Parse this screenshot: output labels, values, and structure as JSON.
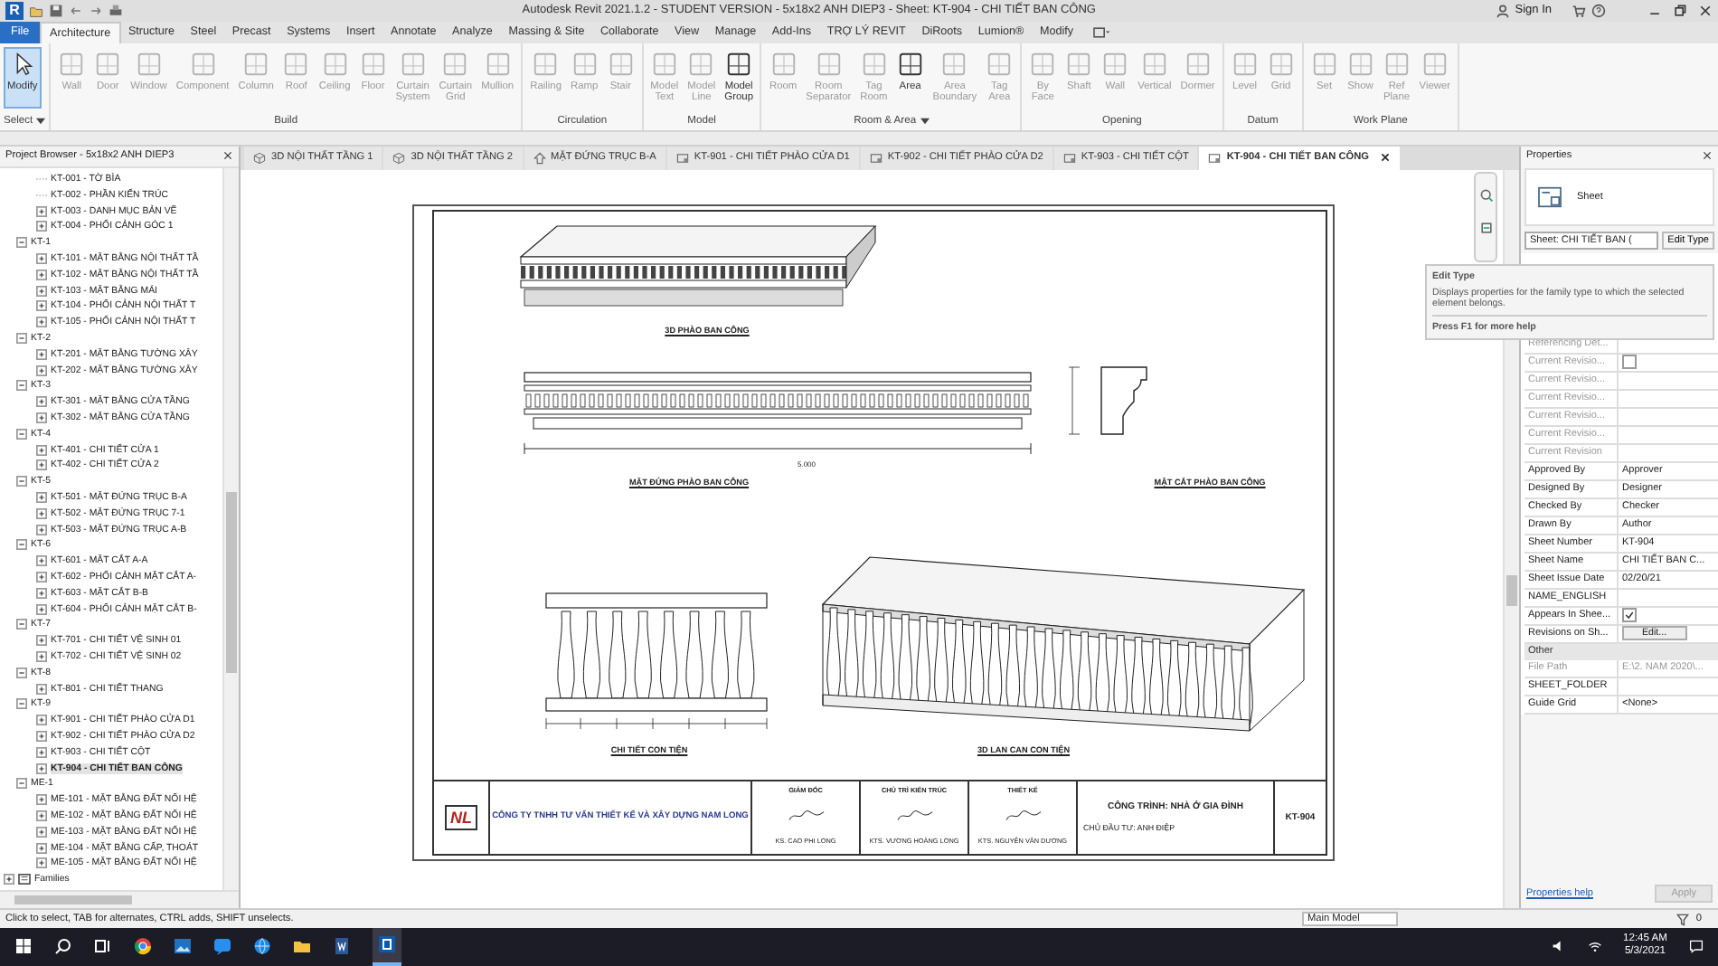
{
  "title_bar": {
    "app_logo": "R",
    "title": "Autodesk Revit 2021.1.2 - STUDENT VERSION - 5x18x2 ANH DIEP3 - Sheet: KT-904 - CHI TIẾT BAN CÔNG",
    "sign_in": "Sign In"
  },
  "ribbon_tabs": [
    {
      "label": "File",
      "kind": "file",
      "selected": false
    },
    {
      "label": "Architecture",
      "kind": "tab",
      "selected": true
    },
    {
      "label": "Structure",
      "kind": "tab",
      "selected": false
    },
    {
      "label": "Steel",
      "kind": "tab",
      "selected": false
    },
    {
      "label": "Precast",
      "kind": "tab",
      "selected": false
    },
    {
      "label": "Systems",
      "kind": "tab",
      "selected": false
    },
    {
      "label": "Insert",
      "kind": "tab",
      "selected": false
    },
    {
      "label": "Annotate",
      "kind": "tab",
      "selected": false
    },
    {
      "label": "Analyze",
      "kind": "tab",
      "selected": false
    },
    {
      "label": "Massing & Site",
      "kind": "tab",
      "selected": false
    },
    {
      "label": "Collaborate",
      "kind": "tab",
      "selected": false
    },
    {
      "label": "View",
      "kind": "tab",
      "selected": false
    },
    {
      "label": "Manage",
      "kind": "tab",
      "selected": false
    },
    {
      "label": "Add-Ins",
      "kind": "tab",
      "selected": false
    },
    {
      "label": "TRỢ LÝ REVIT",
      "kind": "tab",
      "selected": false
    },
    {
      "label": "DiRoots",
      "kind": "tab",
      "selected": false
    },
    {
      "label": "Lumion®",
      "kind": "tab",
      "selected": false
    },
    {
      "label": "Modify",
      "kind": "tab",
      "selected": false
    }
  ],
  "ribbon_panels": [
    {
      "label": "Select",
      "has_menu": true,
      "tools": [
        {
          "label": "Modify",
          "active": true,
          "disabled": false
        }
      ]
    },
    {
      "label": "Build",
      "has_menu": false,
      "tools": [
        {
          "label": "Wall",
          "active": false,
          "disabled": true
        },
        {
          "label": "Door",
          "active": false,
          "disabled": true
        },
        {
          "label": "Window",
          "active": false,
          "disabled": true
        },
        {
          "label": "Component",
          "active": false,
          "disabled": true
        },
        {
          "label": "Column",
          "active": false,
          "disabled": true
        },
        {
          "label": "Roof",
          "active": false,
          "disabled": true
        },
        {
          "label": "Ceiling",
          "active": false,
          "disabled": true
        },
        {
          "label": "Floor",
          "active": false,
          "disabled": true
        },
        {
          "label": "Curtain System",
          "active": false,
          "disabled": true
        },
        {
          "label": "Curtain Grid",
          "active": false,
          "disabled": true
        },
        {
          "label": "Mullion",
          "active": false,
          "disabled": true
        }
      ]
    },
    {
      "label": "Circulation",
      "has_menu": false,
      "tools": [
        {
          "label": "Railing",
          "active": false,
          "disabled": true
        },
        {
          "label": "Ramp",
          "active": false,
          "disabled": true
        },
        {
          "label": "Stair",
          "active": false,
          "disabled": true
        }
      ]
    },
    {
      "label": "Model",
      "has_menu": false,
      "tools": [
        {
          "label": "Model Text",
          "active": false,
          "disabled": true
        },
        {
          "label": "Model Line",
          "active": false,
          "disabled": true
        },
        {
          "label": "Model Group",
          "active": false,
          "disabled": false
        }
      ]
    },
    {
      "label": "Room & Area",
      "has_menu": true,
      "tools": [
        {
          "label": "Room",
          "active": false,
          "disabled": true
        },
        {
          "label": "Room Separator",
          "active": false,
          "disabled": true
        },
        {
          "label": "Tag Room",
          "active": false,
          "disabled": true
        },
        {
          "label": "Area",
          "active": false,
          "disabled": false
        },
        {
          "label": "Area Boundary",
          "active": false,
          "disabled": true
        },
        {
          "label": "Tag Area",
          "active": false,
          "disabled": true
        }
      ]
    },
    {
      "label": "Opening",
      "has_menu": false,
      "tools": [
        {
          "label": "By Face",
          "active": false,
          "disabled": true
        },
        {
          "label": "Shaft",
          "active": false,
          "disabled": true
        },
        {
          "label": "Wall",
          "active": false,
          "disabled": true
        },
        {
          "label": "Vertical",
          "active": false,
          "disabled": true
        },
        {
          "label": "Dormer",
          "active": false,
          "disabled": true
        }
      ]
    },
    {
      "label": "Datum",
      "has_menu": false,
      "tools": [
        {
          "label": "Level",
          "active": false,
          "disabled": true
        },
        {
          "label": "Grid",
          "active": false,
          "disabled": true
        }
      ]
    },
    {
      "label": "Work Plane",
      "has_menu": false,
      "tools": [
        {
          "label": "Set",
          "active": false,
          "disabled": true
        },
        {
          "label": "Show",
          "active": false,
          "disabled": true
        },
        {
          "label": "Ref Plane",
          "active": false,
          "disabled": true
        },
        {
          "label": "Viewer",
          "active": false,
          "disabled": true
        }
      ]
    }
  ],
  "browser": {
    "title": "Project Browser - 5x18x2 ANH DIEP3",
    "continued_items": [
      {
        "label": "KT-001 - TỜ BÌA",
        "expandable": false,
        "selected": false
      },
      {
        "label": "KT-002 - PHẦN KIẾN TRÚC",
        "expandable": false,
        "selected": false
      },
      {
        "label": "KT-003 - DANH MỤC BẢN VẼ",
        "expandable": true,
        "selected": false
      },
      {
        "label": "KT-004 - PHỐI CẢNH GÓC 1",
        "expandable": true,
        "selected": false
      }
    ],
    "groups": [
      {
        "label": "KT-1",
        "expanded": true,
        "children": [
          {
            "label": "KT-101 - MẶT BẰNG NỘI THẤT TẦ",
            "expandable": true,
            "selected": false
          },
          {
            "label": "KT-102 - MẶT BẰNG NỘI THẤT TẦ",
            "expandable": true,
            "selected": false
          },
          {
            "label": "KT-103 - MẶT BẰNG MÁI",
            "expandable": true,
            "selected": false
          },
          {
            "label": "KT-104 - PHỐI CẢNH NỘI THẤT T",
            "expandable": true,
            "selected": false
          },
          {
            "label": "KT-105 - PHỐI CẢNH NỘI THẤT T",
            "expandable": true,
            "selected": false
          }
        ]
      },
      {
        "label": "KT-2",
        "expanded": true,
        "children": [
          {
            "label": "KT-201 - MẶT BẰNG TƯỜNG XÂY",
            "expandable": true,
            "selected": false
          },
          {
            "label": "KT-202 - MẶT BẰNG TƯỜNG XÂY",
            "expandable": true,
            "selected": false
          }
        ]
      },
      {
        "label": "KT-3",
        "expanded": true,
        "children": [
          {
            "label": "KT-301 - MẶT BẰNG CỬA TẦNG",
            "expandable": true,
            "selected": false
          },
          {
            "label": "KT-302 - MẶT BẰNG CỬA TẦNG",
            "expandable": true,
            "selected": false
          }
        ]
      },
      {
        "label": "KT-4",
        "expanded": true,
        "children": [
          {
            "label": "KT-401 - CHI TIẾT CỬA 1",
            "expandable": true,
            "selected": false
          },
          {
            "label": "KT-402 - CHI TIẾT CỬA 2",
            "expandable": true,
            "selected": false
          }
        ]
      },
      {
        "label": "KT-5",
        "expanded": true,
        "children": [
          {
            "label": "KT-501 - MẶT ĐỨNG TRỤC B-A",
            "expandable": true,
            "selected": false
          },
          {
            "label": "KT-502 - MẶT ĐỨNG TRỤC 7-1",
            "expandable": true,
            "selected": false
          },
          {
            "label": "KT-503 - MẶT ĐỨNG TRỤC A-B",
            "expandable": true,
            "selected": false
          }
        ]
      },
      {
        "label": "KT-6",
        "expanded": true,
        "children": [
          {
            "label": "KT-601 - MẶT CẮT A-A",
            "expandable": true,
            "selected": false
          },
          {
            "label": "KT-602 - PHỐI CẢNH MẶT CẮT A-",
            "expandable": true,
            "selected": false
          },
          {
            "label": "KT-603 - MẶT CẮT B-B",
            "expandable": true,
            "selected": false
          },
          {
            "label": "KT-604 - PHỐI CẢNH MẶT CẮT B-",
            "expandable": true,
            "selected": false
          }
        ]
      },
      {
        "label": "KT-7",
        "expanded": true,
        "children": [
          {
            "label": "KT-701 - CHI TIẾT VỆ SINH 01",
            "expandable": true,
            "selected": false
          },
          {
            "label": "KT-702 - CHI TIẾT VỆ SINH 02",
            "expandable": true,
            "selected": false
          }
        ]
      },
      {
        "label": "KT-8",
        "expanded": true,
        "children": [
          {
            "label": "KT-801 - CHI TIẾT THANG",
            "expandable": true,
            "selected": false
          }
        ]
      },
      {
        "label": "KT-9",
        "expanded": true,
        "children": [
          {
            "label": "KT-901 - CHI TIẾT PHÀO CỬA D1",
            "expandable": true,
            "selected": false
          },
          {
            "label": "KT-902 - CHI TIẾT PHÀO CỬA D2",
            "expandable": true,
            "selected": false
          },
          {
            "label": "KT-903 - CHI TIẾT CỘT",
            "expandable": true,
            "selected": false
          },
          {
            "label": "KT-904 - CHI TIẾT BAN CÔNG",
            "expandable": true,
            "selected": true
          }
        ]
      },
      {
        "label": "ME-1",
        "expanded": true,
        "children": [
          {
            "label": "ME-101 - MẶT BẰNG ĐẤT NỐI HỆ",
            "expandable": true,
            "selected": false
          },
          {
            "label": "ME-102 - MẶT BẰNG ĐẤT NỐI HỆ",
            "expandable": true,
            "selected": false
          },
          {
            "label": "ME-103 - MẶT BẰNG ĐẤT NỐI HỆ",
            "expandable": true,
            "selected": false
          },
          {
            "label": "ME-104 - MẶT BẰNG CẤP, THOÁT",
            "expandable": true,
            "selected": false
          },
          {
            "label": "ME-105 - MẶT BẰNG ĐẤT NỐI HỆ",
            "expandable": true,
            "selected": false
          }
        ]
      }
    ],
    "families": {
      "label": "Families",
      "expanded": false
    }
  },
  "view_tabs": [
    {
      "label": "3D NỘI THẤT TẦNG 1",
      "kind": "perspective",
      "selected": false
    },
    {
      "label": "3D NỘI THẤT TẦNG 2",
      "kind": "perspective",
      "selected": false
    },
    {
      "label": "MẶT ĐỨNG TRỤC B-A",
      "kind": "elevation",
      "selected": false
    },
    {
      "label": "KT-901 - CHI TIẾT PHÀO CỬA D1",
      "kind": "sheet",
      "selected": false
    },
    {
      "label": "KT-902 - CHI TIẾT PHÀO CỬA D2",
      "kind": "sheet",
      "selected": false
    },
    {
      "label": "KT-903 - CHI TIẾT CỘT",
      "kind": "sheet",
      "selected": false
    },
    {
      "label": "KT-904 - CHI TIẾT BAN CÔNG",
      "kind": "sheet",
      "selected": true
    }
  ],
  "sheet": {
    "views": [
      {
        "kind": "cornice_3d",
        "label": "3D PHÀO BAN CÔNG"
      },
      {
        "kind": "cornice_elevation",
        "label": "MẶT ĐỨNG PHÀO BAN CÔNG",
        "dimension": "5.000"
      },
      {
        "kind": "cornice_section",
        "label": "MẶT CẮT PHÀO BAN CÔNG"
      },
      {
        "kind": "baluster_elevation",
        "label": "CHI TIẾT CON TIỆN"
      },
      {
        "kind": "railing_3d",
        "label": "3D LAN CAN CON TIỆN"
      }
    ],
    "title_block": {
      "logo": "NL",
      "company": "CÔNG TY TNHH TƯ VẤN THIẾT KẾ VÀ XÂY DỰNG NAM LONG",
      "signers": [
        {
          "role": "GIÁM ĐỐC",
          "name": "KS. CAO PHI LONG"
        },
        {
          "role": "CHỦ TRÌ KIẾN TRÚC",
          "name": "KTS. VƯƠNG HOÀNG LONG"
        },
        {
          "role": "THIẾT KẾ",
          "name": "KTS. NGUYỄN VĂN DƯƠNG"
        }
      ],
      "project": "CÔNG TRÌNH: NHÀ Ở GIA ĐÌNH",
      "owner": "CHỦ ĐẦU TƯ: ANH ĐIỆP",
      "sheet_number": "KT-904"
    }
  },
  "tooltip": {
    "title": "Edit Type",
    "text": "Displays properties for the family type to which the selected element belongs.",
    "help": "Press F1 for more help"
  },
  "properties": {
    "title": "Properties",
    "type_name": "Sheet",
    "selector": "Sheet: CHI TIẾT BAN (",
    "edit_type": "Edit Type",
    "rows": [
      {
        "kind": "text",
        "label": "Referencing Det...",
        "value": "",
        "disabled": true
      },
      {
        "kind": "checkbox",
        "label": "Current Revisio...",
        "checked": false,
        "disabled": true
      },
      {
        "kind": "text",
        "label": "Current Revisio...",
        "value": "",
        "disabled": true
      },
      {
        "kind": "text",
        "label": "Current Revisio...",
        "value": "",
        "disabled": true
      },
      {
        "kind": "text",
        "label": "Current Revisio...",
        "value": "",
        "disabled": true
      },
      {
        "kind": "text",
        "label": "Current Revisio...",
        "value": "",
        "disabled": true
      },
      {
        "kind": "text",
        "label": "Current Revision",
        "value": "",
        "disabled": true
      },
      {
        "kind": "text",
        "label": "Approved By",
        "value": "Approver",
        "disabled": false
      },
      {
        "kind": "text",
        "label": "Designed By",
        "value": "Designer",
        "disabled": false
      },
      {
        "kind": "text",
        "label": "Checked By",
        "value": "Checker",
        "disabled": false
      },
      {
        "kind": "text",
        "label": "Drawn By",
        "value": "Author",
        "disabled": false
      },
      {
        "kind": "text",
        "label": "Sheet Number",
        "value": "KT-904",
        "disabled": false
      },
      {
        "kind": "text",
        "label": "Sheet Name",
        "value": "CHI TIẾT BAN C...",
        "disabled": false
      },
      {
        "kind": "text",
        "label": "Sheet Issue Date",
        "value": "02/20/21",
        "disabled": false
      },
      {
        "kind": "text",
        "label": "NAME_ENGLISH",
        "value": "",
        "disabled": false
      },
      {
        "kind": "checkbox",
        "label": "Appears In Shee...",
        "checked": true,
        "disabled": false
      },
      {
        "kind": "button",
        "label": "Revisions on Sh...",
        "value": "Edit...",
        "disabled": false
      },
      {
        "kind": "section",
        "label": "Other"
      },
      {
        "kind": "text",
        "label": "File Path",
        "value": "E:\\2. NAM 2020\\...",
        "disabled": true
      },
      {
        "kind": "text",
        "label": "SHEET_FOLDER",
        "value": "",
        "disabled": false
      },
      {
        "kind": "text",
        "label": "Guide Grid",
        "value": "<None>",
        "disabled": false
      }
    ],
    "help_link": "Properties help",
    "apply": "Apply"
  },
  "status_bar": {
    "message": "Click to select, TAB for alternates, CTRL adds, SHIFT unselects.",
    "model": "Main Model",
    "filter_count": "0"
  },
  "taskbar": {
    "time": "12:45 AM",
    "date": "5/3/2021"
  }
}
